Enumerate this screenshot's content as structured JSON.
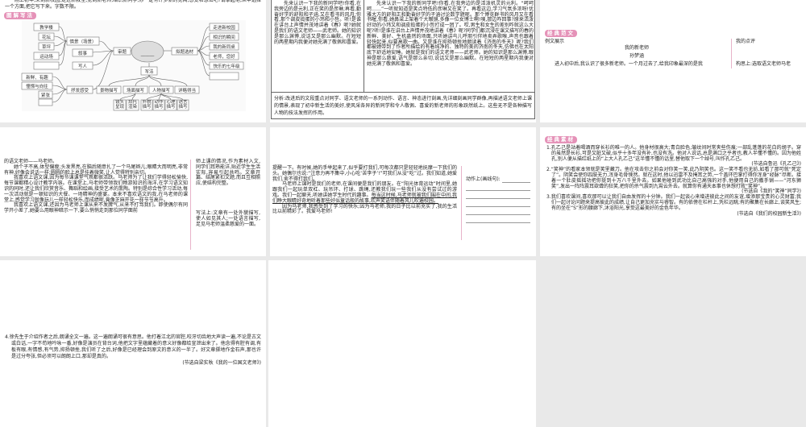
{
  "panel1": {
    "prompt": "刚上初中,来到新校园,走进新教室,见到新老师,结识新同学,你一定有许多新的见闻,感受和想法吧?请拿起笔,从中选择一个方面,把它写下来。字数不限。",
    "badge": "图解写法",
    "mindmap": {
      "center_blank": "______",
      "scene_items": [
        "教学楼",
        "花坛",
        "草坪",
        "运动场"
      ],
      "scene": "情景（场景）",
      "narrate": "叙事",
      "person": "写人",
      "feel_items": [
        "新鲜、有趣",
        "憧憬与向往",
        "紧张"
      ],
      "feel": "抒发感受",
      "review": "审题",
      "select": "拟题选材",
      "topics": [
        "走进新校园",
        "相识的瞬间",
        "我的新同桌",
        "老师，您好",
        "快乐的七年级"
      ],
      "method": "写法",
      "methods": [
        "景物描写",
        "场面描写",
        "人物描写",
        "详略得当"
      ],
      "sub_methods": [
        "镜头呈现",
        "烘托渲染",
        "外貌描写",
        "动作描写",
        "心理描写",
        "语言描写"
      ]
    }
  },
  "panel2": {
    "left": "先来认识一下我的新同学吧!你看,在我旁边的是元利,正在笑的是彦琳;再看,勤奋好学的舒阳和子涵,又在看书的风月;你看,那个调皮捣蛋的小玮和小哲。听!是谁在讲台上声情并茂地讲着《春》呢?她就是我们的语文老师——武老师。她的知识是那么渊博,说话又是那么幽默。在短短的两星期内我便对她充满了敬佩和喜爱。",
    "right": "先来认识一下我的新同学吧!你看,在我旁边的是活泼机灵的元利。“呵呵呵……”一听就知道是笑点特低的彦琳又在笑了。再看这边,学习气氛多浓呀!优雅大方的舒阳正和勤奋好学的子涵讨论数学题呢。那个博览群书的风月又在看书喔,你看,她鼻梁上架着个大眼镜,多像一位女博士啊!咦,那边咋回事?原来活泼好动的小玮又和调皮捣蛋的小哲打成一团了。哎,男生和女生的差别咋就这么大呢?听!是谁在讲台上声情并茂地讲着《春》呢?同学们都沉浸在课文描写的春的新鲜、美好、生机盎然的场面,只听她讲鸟儿呼朋引伴地卖弄歌喉,声音也跟着轻快起来,似要高歌一曲。又是谁在抑扬顿挫地朗读着《济南的冬天》呢?我们都被她带到了作者所描绘的有着纯净的、独特的美的济南的冬天,仿佛也在太阳底下舒适地安睡。她就是我们的语文老师——武老师。她的知识是那么渊博,眼神是那么慈爱,语气是那么亲切,说话又是那么幽默。在短短的两星期内我便对她充满了敬佩和喜爱。",
    "analysis": "分析:改进后的文段重点对同学、语文老师的一系列动作、语言、神态进行刻画,先详细刻画同学群像,再描述语文老师上课的情景,表现了初中新生活的美好,使风采各异的新同学和令人敬佩、喜爱的新老师的形象跃然纸上。这些无不是各种描写人物的技法发挥的作用。"
  },
  "panel3": {
    "badge": "经典范文",
    "example_label": "例文展示",
    "comment_label": "我的点评",
    "essay_title": "我的新老师",
    "author": "孙梦涵",
    "first_line": "进入初中后,我认识了很多新老师。一个月过去了,给我印象最深的是我",
    "comment": "构思上:选取语文老师马老"
  },
  "panel4": {
    "paragraphs": [
      "的语文老师——马老师。",
      "她个子不高,体型偏瘦;头发黑亮,在脑后随意扎了一个马尾辫儿;眼睛大而明亮,非常有神,好像会说话一样;圆圆的脸上总是挂着微笑,让人觉得特别亲切。",
      "我喜欢上语文课,因为每节课课堂气氛都很活跃。马老师为了让我们学得轻松愉快,每节课都精心设计教学内容。在课堂上,马老师带领我们畅游知识的海洋,在学习语文知识的同时,还让我们欣赏音乐、舞蹈和绘画,接受艺术的熏陶。特别是综合性学习活动,每一次活动就是一顿知识的大餐、一场精神的盛宴。本来不喜欢语文的我,在马老师的课堂上,感觉学习就像玩儿一样轻松快乐,而成绩呢,竟像芝麻开花一样节节高升。",
      "我喜欢上语文课,还因为马老师上课从来不发脾气,从来不打骂我们。即使偶尔有同学开小差了,她要么用眼神暗示一下,要么悄悄走到那位同学面前"
    ],
    "comments": [
      "师上课的情况,作为素材入文,同学们耳熟能详,贴近学生生活实际,容易引起共鸣。文章开篇、结尾紧扣文题,而且互相照应,使结构完整。",
      "写法上:文章有一处外貌描写,使人如见其人;一处语言描写,足见马老师温柔慈爱的一面。"
    ]
  },
  "panel5": {
    "p0": "提醒一下。有时候,她的手举起来了,似乎要打我们,可每次都只是轻轻地抚摩一下我们的头。她偶尔也说:“注意力再不集中,小心吃‘苦李子’!”可我们从没“吃”过。我们知道,她爱我们,舍不得打我们。",
    "p1": "马老师上课时是我们的老师,在课间便是我们的朋友。在“阳光体育运动”时间里,她跟我们一起玩单双杠、玩吊环、打球、跳绳,还教我们玩一些我们从没有尝试过的游戏。我们一起聊天,听她讲她学生时代的趣事。",
    "p1_underlined": "每当这时候,马老师就被我们围在中间,我们睁大眼睛好奇地听着那些好似童话般的故事,欢声笑语伴随着风儿吹遍校园。",
    "p2": "因为马老师,我感受到了学习的快乐;因为马老师,我的日子比以前充实了,我的生活比以前精彩了。我爱马老师!",
    "comment_prompt": "动作上(画线句):"
  },
  "panel6": {
    "badge": "经典素材",
    "items": [
      {
        "text": "1.孔乙己是站着喝酒而穿长衫的唯一的人。他身材很高大;青白脸色,皱纹间时常夹些伤痕;一部乱蓬蓬的花白的胡子。穿的虽然是长衫,可是又脏又破,似乎十多年没有补,也没有洗。他对人说话,总是满口之乎者也,教人半懂不懂的。因为他姓孔,别人便从描红纸上的“上大人孔乙己”这半懂不懂的话里,替他取下一个绰号,叫作孔乙己。",
        "source": "(节选自鲁迅《孔乙己》)"
      },
      {
        "text": "2.“笑神”的看家本领就是笑里藏刀。他在攻击你之前会对你笑一笑,此乃阴笑也。这一笑不看也无妨,如看了那可就“死定了”。阴笑会使你四肢无力,浑身毛骨悚然。就在这时,他以迅雷不及掩耳之势,一个盖环巴掌打得你浑身“经脉”尽断。接着一个肚皮摇摇功把你挺到十万八千里外去。如果他碰到武功比自己高强的对手,他便用自己的撒手锏——“河东狮笑”,发出一阵阵震耳欲聋的狂笑,把你的杀气震到九霄云外去。就算你有通天本事也休想打败“笑神”。",
        "source": "(节选自《我的“笑神”同学》)"
      },
      {
        "text": "3.我们喜欢课间,喜欢那可以让我们自由发挥的十分钟。我们一起谈心来增进彼此之间的友谊,增添那宝贵的心灵财富;我们一起讨论问题来提高彼此的成绩,让自己更加充实与睿智。有的依傍在栏杆上,凭栏远眺;有的聚集在长廊上,谈笑风生;有的坐在“S”形的腰廊下,沐浴阳光,享受这最美好的金色年华。",
        "source": "(节选自《我们的校园新生活》)"
      }
    ]
  },
  "panel7": {
    "text": "4.徐先生于介绍作者之后,朗诵全文一遍。这一遍朗诵可很有意思。他打着江北的官腔,咬牙切齿地大声读一遍,不论是古文或白话,一字不苟地吟咏一番,好像是演员在背台词,他把文字里蕴藏着的意义好像都给宣泄出来了。他念得有腔有调,有板有眼,有情感,有气势,抑扬顿挫,我们听了之后,好像是已经理会到原文的意义的一半了。好文章掷地作金石声,那也许是过分夸张,但必须可以朗朗上口,那却是真的。",
    "source": "(节选自梁实秋《我的一位国文老师》)"
  }
}
